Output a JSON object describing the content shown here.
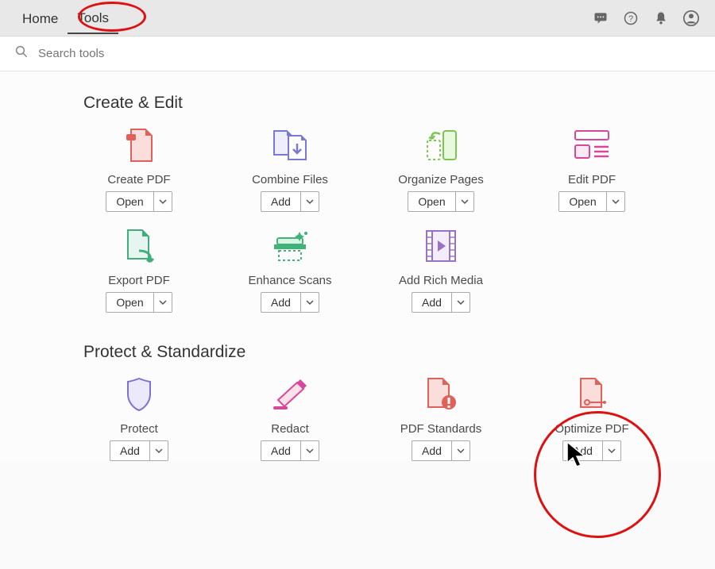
{
  "nav": {
    "home": "Home",
    "tools": "Tools"
  },
  "search": {
    "placeholder": "Search tools"
  },
  "sections": {
    "create": "Create & Edit",
    "protect": "Protect & Standardize"
  },
  "tools": {
    "create_pdf": {
      "label": "Create PDF",
      "button": "Open"
    },
    "combine_files": {
      "label": "Combine Files",
      "button": "Add"
    },
    "organize_pages": {
      "label": "Organize Pages",
      "button": "Open"
    },
    "edit_pdf": {
      "label": "Edit PDF",
      "button": "Open"
    },
    "export_pdf": {
      "label": "Export PDF",
      "button": "Open"
    },
    "enhance_scans": {
      "label": "Enhance Scans",
      "button": "Add"
    },
    "add_rich_media": {
      "label": "Add Rich Media",
      "button": "Add"
    },
    "protect": {
      "label": "Protect",
      "button": "Add"
    },
    "redact": {
      "label": "Redact",
      "button": "Add"
    },
    "pdf_standards": {
      "label": "PDF Standards",
      "button": "Add"
    },
    "optimize_pdf": {
      "label": "Optimize PDF",
      "button": "Add"
    }
  }
}
